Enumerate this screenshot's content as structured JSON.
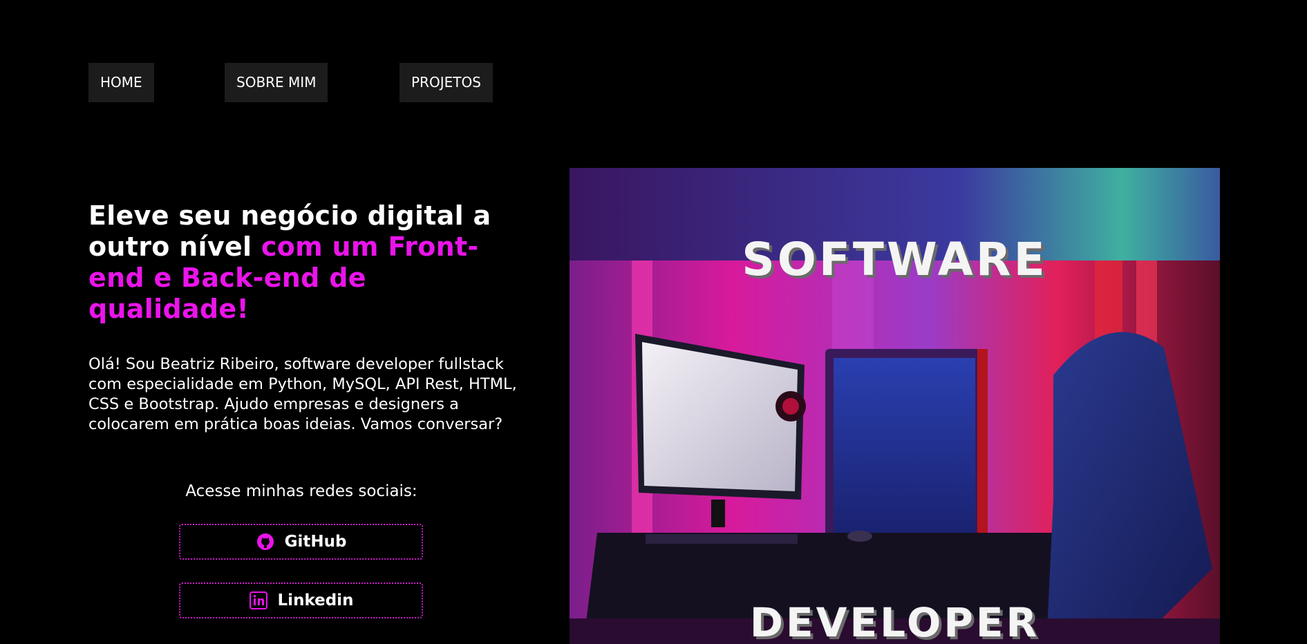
{
  "nav": {
    "items": [
      {
        "label": "HOME"
      },
      {
        "label": "SOBRE MIM"
      },
      {
        "label": "PROJETOS"
      }
    ]
  },
  "hero": {
    "headline_white": "Eleve seu negócio digital a outro nível",
    "headline_highlight": "com um Front-end e Back-end de qualidade!",
    "intro": "Olá! Sou Beatriz Ribeiro, software developer fullstack com especialidade em Python, MySQL, API Rest, HTML, CSS e Bootstrap. Ajudo empresas e designers a colocarem em prática boas ideias. Vamos conversar?",
    "image_text_top": "SOFTWARE",
    "image_text_bottom": "DEVELOPER"
  },
  "social": {
    "title": "Acesse minhas redes sociais:",
    "links": [
      {
        "label": "GitHub",
        "icon": "github-icon"
      },
      {
        "label": "Linkedin",
        "icon": "linkedin-icon"
      }
    ]
  },
  "colors": {
    "background": "#000000",
    "accent": "#ea14ea",
    "nav_bg": "#1c1c1c",
    "button_border": "#d21bd2"
  }
}
